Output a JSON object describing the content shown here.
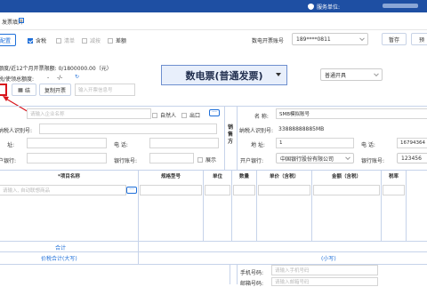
{
  "header": {
    "service_label": "服务单位:"
  },
  "titlebar": {
    "title": "发票填开"
  },
  "toolbar": {
    "config": "配置",
    "tax_included": "含税",
    "list": "清单",
    "reduce": "减按",
    "discount": "差额",
    "account_label": "数电开票账号",
    "account_value": "189****0811",
    "draft": "暂存",
    "preview": "预"
  },
  "quota": {
    "line1": "额度/近12个月开票限额: 0/1800000.00（元）",
    "line2_label": "税/使领总额度:",
    "line2_v1": "-",
    "line2_v2": "-/-"
  },
  "invoice": {
    "title": "数电票(普通发票)",
    "issue_type": "普通开具"
  },
  "actions": {
    "open": "结",
    "copy": "复制开票",
    "search_placeholder": "输入开票信息号"
  },
  "buyer": {
    "name_placeholder": "请输入企业名称",
    "natural_person": "自然人",
    "export": "出口",
    "tax_id_label": "纳税人识别号:",
    "address_label": "址:",
    "phone_label": "电    话:",
    "bank_label": "户银行:",
    "account_label": "银行账号:",
    "show": "展示"
  },
  "seller_side": {
    "title": "销售方"
  },
  "seller": {
    "name_label": "名    称:",
    "name_value": "SMB模拟账号",
    "tax_id_label": "纳税人识别号:",
    "tax_id_value": "33888888885MB",
    "address_label": "地    址:",
    "address_value": "1",
    "phone_label": "电    话:",
    "phone_value": "16794364",
    "bank_label": "开户银行:",
    "bank_value": "中国银行股份有限公司",
    "account_label": "银行账号:",
    "account_value": "123456"
  },
  "table": {
    "cols": [
      "*项目名称",
      "规格型号",
      "单位",
      "数量",
      "单价（含税）",
      "金额（含税）",
      "税率"
    ],
    "item_placeholder": "请输入, 自动联想商品",
    "total_label": "合计",
    "total_words_label": "价税合计(大写)",
    "total_lower_label": "(小写)"
  },
  "bottom": {
    "phone_label": "手机号码:",
    "phone_placeholder": "请输入手机号码",
    "email_label": "邮箱号码:",
    "email_placeholder": "请输入邮箱号码"
  }
}
